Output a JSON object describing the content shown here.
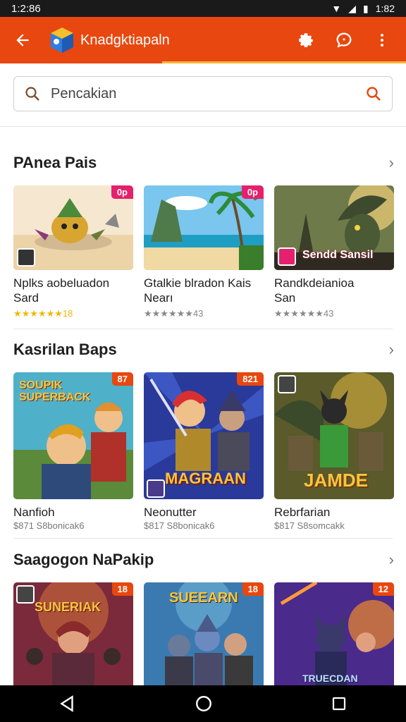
{
  "status": {
    "time": "1:2:86",
    "clock_right": "1:82"
  },
  "app_bar": {
    "title": "Knadgktiapaln"
  },
  "search": {
    "placeholder": "Pencakian"
  },
  "sections": [
    {
      "title": "PAnea Pais",
      "cards": [
        {
          "title_line1": "Nplks aobeluadon",
          "title_line2": "Sard",
          "rating_text": "★★★★★★18",
          "badge": "0p"
        },
        {
          "title_line1": "Gtalkie blradon Kais",
          "title_line2": "Nearı",
          "rating_text": "★★★★★★43",
          "badge": "0p"
        },
        {
          "title_line1": "Randkdeianioa",
          "title_line2": "San",
          "rating_text": "★★★★★★43",
          "overlay_text": "Sendd Sansil"
        }
      ]
    },
    {
      "title": "Kasrilan Baps",
      "cards": [
        {
          "title_line1": "Nanfioh",
          "sub": "$871 S8bonicak6",
          "badge": "87",
          "overlay_text": "SOUPIK SUPERBACK"
        },
        {
          "title_line1": "Neonutter",
          "sub": "$817 S8bonicak6",
          "badge": "821",
          "overlay_text": "MAGRAAN"
        },
        {
          "title_line1": "Rebrfarian",
          "sub": "$817 S8somcakk",
          "overlay_text": "JAMDE"
        }
      ]
    },
    {
      "title": "Saagogon NaPakip",
      "cards": [
        {
          "badge": "18",
          "overlay_text": "SUNERIAK"
        },
        {
          "badge": "18",
          "overlay_text": "SUEEARN"
        },
        {
          "badge": "12",
          "overlay_text": "TRUECDAN"
        }
      ]
    }
  ],
  "colors": {
    "app_bar": "#e8470f",
    "accent": "#f6b73c",
    "badge": "#e8470f",
    "badge_pink": "#e5206c"
  }
}
